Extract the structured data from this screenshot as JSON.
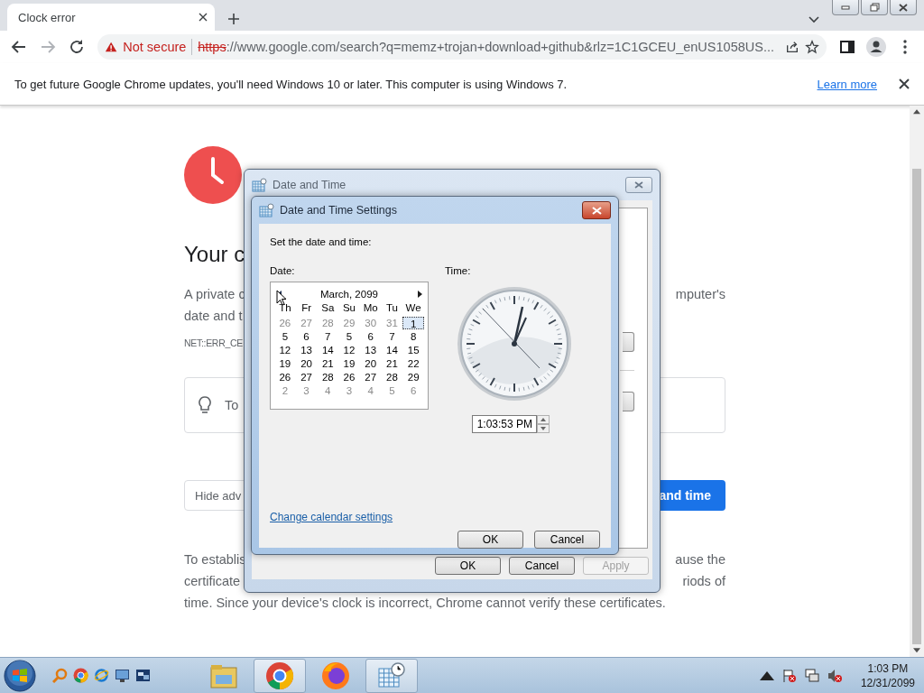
{
  "browser": {
    "tab": {
      "title": "Clock error"
    },
    "address": {
      "security": "Not secure",
      "scheme": "https",
      "rest": "://www.google.com/search?q=memz+trojan+download+github&rlz=1C1GCEU_enUS1058US..."
    },
    "infobar": {
      "text": "To get future Google Chrome updates, you'll need Windows 10 or later. This computer is using Windows 7.",
      "link": "Learn more"
    }
  },
  "page": {
    "heading": "Your c",
    "intro_left": [
      "A private c",
      "date and t"
    ],
    "intro_right": "mputer's",
    "error_code": "NET::ERR_CE",
    "tip": "To",
    "hide_button": "Hide adv",
    "action_button": "and time",
    "details_left": [
      "To establis",
      "certificate"
    ],
    "details_right": [
      "ause the",
      "riods of"
    ],
    "details_last": "time. Since your device's clock is incorrect, Chrome cannot verify these certificates."
  },
  "outer_dialog": {
    "title": "Date and Time",
    "buttons": [
      {
        "label": "OK",
        "disabled": false
      },
      {
        "label": "Cancel",
        "disabled": false
      },
      {
        "label": "Apply",
        "disabled": true
      }
    ]
  },
  "settings_dialog": {
    "title": "Date and Time Settings",
    "prompt": "Set the date and time:",
    "date_label": "Date:",
    "time_label": "Time:",
    "calendar": {
      "month": "March, 2099",
      "weekdays": [
        "Th",
        "Fr",
        "Sa",
        "Su",
        "Mo",
        "Tu",
        "We"
      ],
      "weeks": [
        [
          {
            "day": "26",
            "other_month": true,
            "selected": false
          },
          {
            "day": "27",
            "other_month": true,
            "selected": false
          },
          {
            "day": "28",
            "other_month": true,
            "selected": false
          },
          {
            "day": "29",
            "other_month": true,
            "selected": false
          },
          {
            "day": "30",
            "other_month": true,
            "selected": false
          },
          {
            "day": "31",
            "other_month": true,
            "selected": false
          },
          {
            "day": "1",
            "other_month": false,
            "selected": true
          }
        ],
        [
          {
            "day": "5",
            "other_month": false,
            "selected": false
          },
          {
            "day": "6",
            "other_month": false,
            "selected": false
          },
          {
            "day": "7",
            "other_month": false,
            "selected": false
          },
          {
            "day": "5",
            "other_month": false,
            "selected": false
          },
          {
            "day": "6",
            "other_month": false,
            "selected": false
          },
          {
            "day": "7",
            "other_month": false,
            "selected": false
          },
          {
            "day": "8",
            "other_month": false,
            "selected": false
          }
        ],
        [
          {
            "day": "12",
            "other_month": false,
            "selected": false
          },
          {
            "day": "13",
            "other_month": false,
            "selected": false
          },
          {
            "day": "14",
            "other_month": false,
            "selected": false
          },
          {
            "day": "12",
            "other_month": false,
            "selected": false
          },
          {
            "day": "13",
            "other_month": false,
            "selected": false
          },
          {
            "day": "14",
            "other_month": false,
            "selected": false
          },
          {
            "day": "15",
            "other_month": false,
            "selected": false
          }
        ],
        [
          {
            "day": "19",
            "other_month": false,
            "selected": false
          },
          {
            "day": "20",
            "other_month": false,
            "selected": false
          },
          {
            "day": "21",
            "other_month": false,
            "selected": false
          },
          {
            "day": "19",
            "other_month": false,
            "selected": false
          },
          {
            "day": "20",
            "other_month": false,
            "selected": false
          },
          {
            "day": "21",
            "other_month": false,
            "selected": false
          },
          {
            "day": "22",
            "other_month": false,
            "selected": false
          }
        ],
        [
          {
            "day": "26",
            "other_month": false,
            "selected": false
          },
          {
            "day": "27",
            "other_month": false,
            "selected": false
          },
          {
            "day": "28",
            "other_month": false,
            "selected": false
          },
          {
            "day": "26",
            "other_month": false,
            "selected": false
          },
          {
            "day": "27",
            "other_month": false,
            "selected": false
          },
          {
            "day": "28",
            "other_month": false,
            "selected": false
          },
          {
            "day": "29",
            "other_month": false,
            "selected": false
          }
        ],
        [
          {
            "day": "2",
            "other_month": true,
            "selected": false
          },
          {
            "day": "3",
            "other_month": true,
            "selected": false
          },
          {
            "day": "4",
            "other_month": true,
            "selected": false
          },
          {
            "day": "3",
            "other_month": true,
            "selected": false
          },
          {
            "day": "4",
            "other_month": true,
            "selected": false
          },
          {
            "day": "5",
            "other_month": true,
            "selected": false
          },
          {
            "day": "6",
            "other_month": true,
            "selected": false
          }
        ]
      ]
    },
    "time": "1:03:53 PM",
    "link": "Change calendar settings",
    "buttons": [
      "OK",
      "Cancel"
    ]
  },
  "taskbar": {
    "apps": [
      {
        "kind": "folder",
        "selected": false
      },
      {
        "kind": "chrome",
        "selected": true
      },
      {
        "kind": "firefox",
        "selected": false
      },
      {
        "kind": "calendar",
        "selected": true
      }
    ],
    "clock": {
      "time": "1:03 PM",
      "date": "12/31/2099"
    }
  }
}
